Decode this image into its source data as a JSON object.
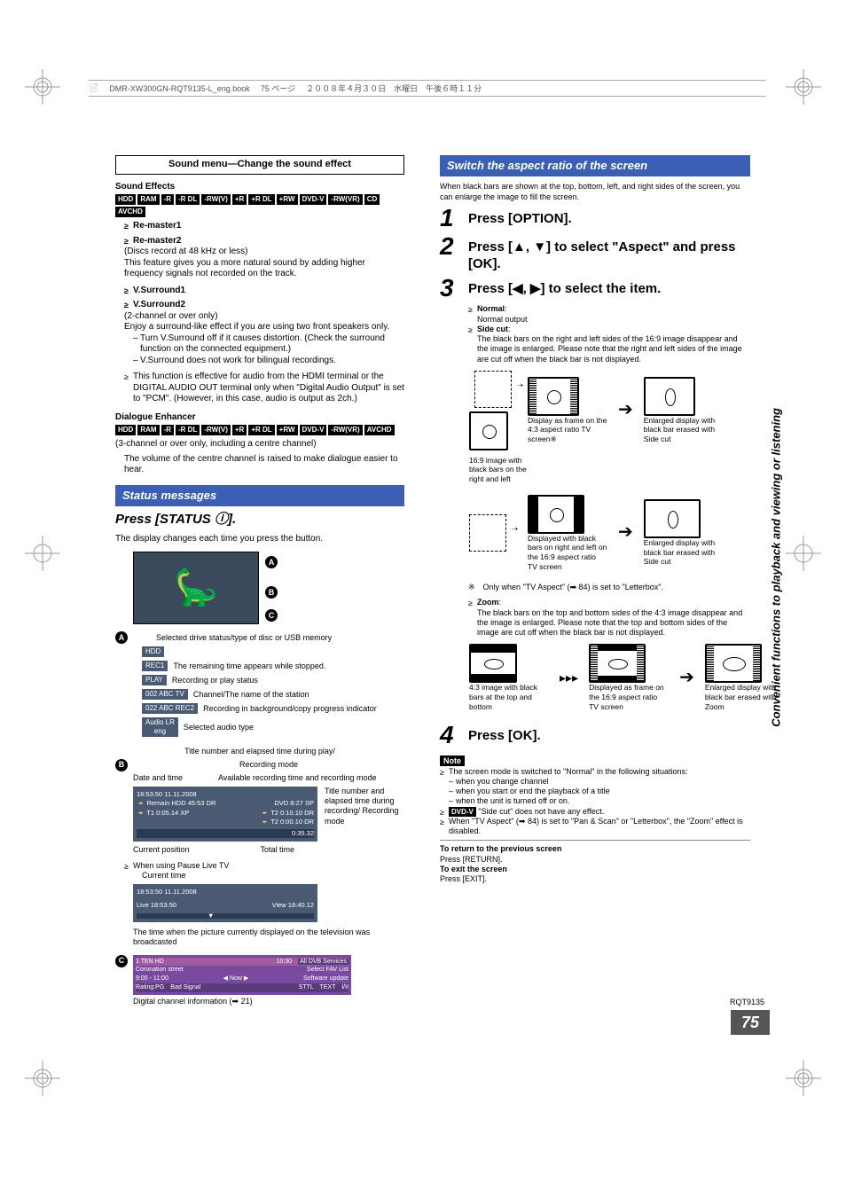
{
  "header": {
    "file": "DMR-XW300GN-RQT9135-L_eng.book",
    "page_spec": "75 ページ",
    "date": "２００８年４月３０日　水曜日　午後６時１１分"
  },
  "left": {
    "sound_menu_title": "Sound menu—Change the sound effect",
    "sound_effects_heading": "Sound Effects",
    "fmt_tags_a": [
      "HDD",
      "RAM",
      "-R",
      "-R DL",
      "-RW(V)",
      "+R",
      "+R DL",
      "+RW",
      "DVD-V",
      "-RW(VR)",
      "CD",
      "AVCHD"
    ],
    "remaster1": "Re-master1",
    "remaster2": "Re-master2",
    "remaster_note1": "(Discs record at 48 kHz or less)",
    "remaster_note2": "This feature gives you a more natural sound by adding higher frequency signals not recorded on the track.",
    "vsurround1": "V.Surround1",
    "vsurround2": "V.Surround2",
    "vsurround_note1": "(2-channel or over only)",
    "vsurround_note2": "Enjoy a surround-like effect if you are using two front speakers only.",
    "vsurround_sub1": "Turn V.Surround off if it causes distortion. (Check the surround function on the connected equipment.)",
    "vsurround_sub2": "V.Surround does not work for bilingual recordings.",
    "hdmi_note": "This function is effective for audio from the HDMI terminal or the DIGITAL AUDIO OUT terminal only when \"Digital Audio Output\" is set to \"PCM\". (However, in this case, audio is output as 2ch.)",
    "dialogue_heading": "Dialogue Enhancer",
    "fmt_tags_b": [
      "HDD",
      "RAM",
      "-R",
      "-R DL",
      "-RW(V)",
      "+R",
      "+R DL",
      "+RW",
      "DVD-V",
      "-RW(VR)",
      "AVCHD"
    ],
    "dialogue_note1": "(3-channel or over only, including a centre channel)",
    "dialogue_note2": "The volume of the centre channel is raised to make dialogue easier to hear.",
    "status_bar": "Status messages",
    "press_status": "Press [STATUS ⓘ].",
    "press_status_sub": "The display changes each time you press the button.",
    "A_label_1": "Selected drive status/type of disc or USB memory",
    "A_hdd": "HDD",
    "A_rec1": "REC1",
    "A_label_2": "The remaining time appears while stopped.",
    "A_play": "PLAY",
    "A_label_3": "Recording or play status",
    "A_ch": "002 ABC TV",
    "A_label_4": "Channel/The name of the station",
    "A_rec2": "022 ABC REC2",
    "A_label_5": "Recording in background/copy progress indicator",
    "A_audio": "Audio LR\neng",
    "A_label_6": "Selected audio type",
    "B_intro1": "Title number and elapsed time during play/",
    "B_intro2": "Recording mode",
    "B_dt_label": "Date and time",
    "B_avail_label": "Available recording time and recording mode",
    "B_right_label": "Title number and elapsed time during recording/ Recording mode",
    "osd": {
      "line1_left": "18:53:50 11.11.2008",
      "remain": "Remain HDD 45:53 DR",
      "dvd": "DVD 8:27 SP",
      "t1": "T1  0:05.14  XP",
      "t2a": "T2  0:10.10  DR",
      "t2b": "T2  0:00.10  DR",
      "pos": "0:35.32"
    },
    "current_pos": "Current position",
    "total_time": "Total time",
    "pause_tv": "When using Pause Live TV",
    "current_time": "Current time",
    "osd2": {
      "line1": "18:53:50 11.11.2008",
      "live": "Live  18:53.50",
      "view": "View  18:40.12"
    },
    "broadcast_note": "The time when the picture currently displayed on the television was broadcasted",
    "ch_info": {
      "ch": "1 TEN HD",
      "time": "10:30",
      "svc": "All DVB Services",
      "prog": "Coronation street",
      "fav": "Select FAV List",
      "slot": "9:00 - 11:00",
      "now": "◀ Now ▶",
      "upd": "Software update",
      "rating": "Rating:PG",
      "signal": "Bad Signal",
      "sttl": "STTL",
      "text": "TEXT",
      "audio": "I/II"
    },
    "dci": "Digital channel information (➡ 21)"
  },
  "right": {
    "aspect_bar": "Switch the aspect ratio of the screen",
    "aspect_intro": "When black bars are shown at the top, bottom, left, and right sides of the screen, you can enlarge the image to fill the screen.",
    "step1": "Press [OPTION].",
    "step2": "Press [▲, ▼] to select \"Aspect\" and press [OK].",
    "step3": "Press [◀, ▶] to select the item.",
    "normal_h": "Normal",
    "normal_t": "Normal output",
    "side_h": "Side cut",
    "side_t": "The black bars on the right and left sides of the 16:9 image disappear and the image is enlarged. Please note that the right and left sides of the image are cut off when the black bar is not displayed.",
    "c169": "16:9 image with black bars on the right and left",
    "d43": "Display as frame on the 4:3 aspect ratio TV screen※",
    "e_side": "Enlarged display with black bar erased with Side cut",
    "d169_black": "Displayed with black bars on right and left on the 16:9 aspect ratio TV screen",
    "footnote": "※　Only when \"TV Aspect\" (➡ 84) is set to \"Letterbox\".",
    "zoom_h": "Zoom",
    "zoom_t": "The black bars on the top and bottom sides of the 4:3 image disappear and the image is enlarged. Please note that the top and bottom sides of the image are cut off when the black bar is not displayed.",
    "c43": "4:3 image with black bars at the top and bottom",
    "d169f": "Displayed as frame on the 16:9 aspect ratio TV screen",
    "e_zoom": "Enlarged display with black bar erased with Zoom",
    "step4": "Press [OK].",
    "note_label": "Note",
    "note1": "The screen mode is switched to \"Normal\" in the following situations:",
    "note1a": "when you change channel",
    "note1b": "when you start or end the playback of a title",
    "note1c": "when the unit is turned off or on.",
    "note2a_tag": "DVD-V",
    "note2a": "\"Side cut\" does not have any effect.",
    "note3": "When \"TV Aspect\" (➡ 84) is set to \"Pan & Scan\" or \"Letterbox\", the \"Zoom\" effect is disabled.",
    "ret1": "To return to the previous screen",
    "ret1a": "Press [RETURN].",
    "ret2": "To exit the screen",
    "ret2a": "Press [EXIT]."
  },
  "sidebar": "Convenient functions to playback and viewing or listening",
  "page_number": "75",
  "rqt": "RQT9135"
}
